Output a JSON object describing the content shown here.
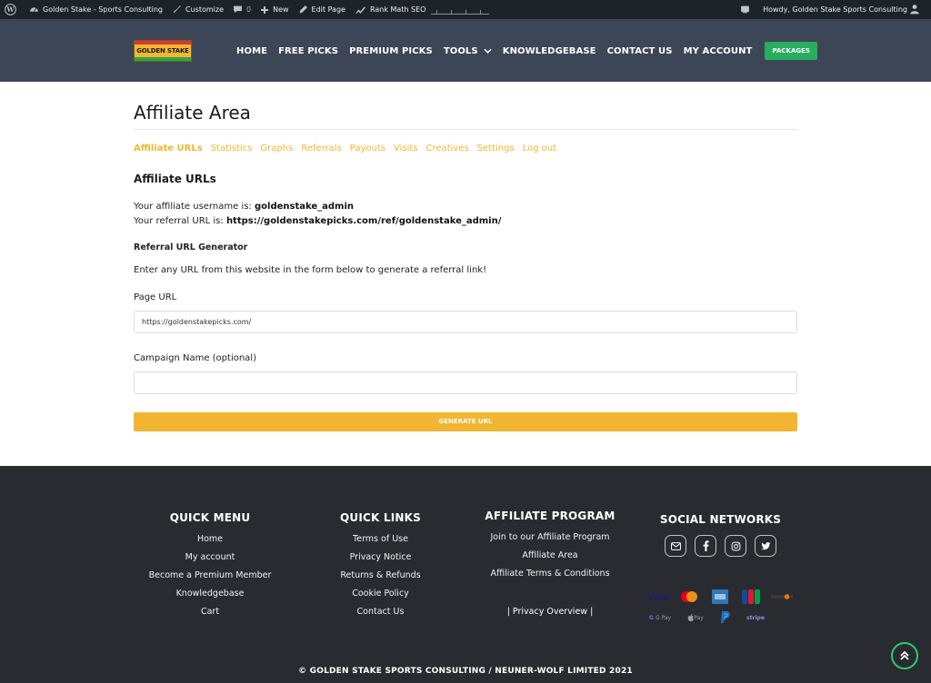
{
  "admin_bar": {
    "site_name": "Golden Stake - Sports Consulting",
    "customize": "Customize",
    "comments_count": "0",
    "new": "New",
    "edit_page": "Edit Page",
    "rank_math": "Rank Math SEO",
    "howdy": "Howdy, Golden Stake Sports Consulting"
  },
  "header": {
    "logo_text": "GOLDEN STAKE",
    "nav": [
      "HOME",
      "FREE PICKS",
      "PREMIUM PICKS",
      "TOOLS",
      "KNOWLEDGEBASE",
      "CONTACT US",
      "MY ACCOUNT"
    ],
    "packages_label": "PACKAGES"
  },
  "page": {
    "title": "Affiliate Area",
    "tabs": [
      "Affiliate URLs",
      "Statistics",
      "Graphs",
      "Referrals",
      "Payouts",
      "Visits",
      "Creatives",
      "Settings",
      "Log out"
    ],
    "section_title": "Affiliate URLs",
    "username_label": "Your affiliate username is:",
    "username_value": "goldenstake_admin",
    "referral_label": "Your referral URL is:",
    "referral_value": "https://goldenstakepicks.com/ref/goldenstake_admin/",
    "generator_title": "Referral URL Generator",
    "generator_desc": "Enter any URL from this website in the form below to generate a referral link!",
    "page_url_label": "Page URL",
    "page_url_value": "https://goldenstakepicks.com/",
    "campaign_label": "Campaign Name (optional)",
    "campaign_value": "",
    "generate_label": "GENERATE URL"
  },
  "footer": {
    "quick_menu": {
      "title": "QUICK MENU",
      "items": [
        "Home",
        "My account",
        "Become a Premium Member",
        "Knowledgebase",
        "Cart"
      ]
    },
    "quick_links": {
      "title": "QUICK LINKS",
      "items": [
        "Terms of Use",
        "Privacy Notice",
        "Returns & Refunds",
        "Cookie Policy",
        "Contact Us"
      ]
    },
    "affiliate": {
      "title": "AFFILIATE PROGRAM",
      "items": [
        "Join to our Affiliate Program",
        "Affiliate Area",
        "Affiliate Terms & Conditions"
      ],
      "privacy": "| Privacy Overview |"
    },
    "social": {
      "title": "SOCIAL NETWORKS",
      "icons": [
        "email-icon",
        "facebook-icon",
        "instagram-icon",
        "twitter-icon"
      ]
    },
    "payments": {
      "row1": [
        "visa-icon",
        "mastercard-icon",
        "amex-icon",
        "jcb-icon",
        "discover-icon"
      ],
      "gpay": "G Pay",
      "applepay": "Pay",
      "stripe": "stripe"
    },
    "copyright": "© GOLDEN STAKE SPORTS CONSULTING / NEUNER-WOLF LIMITED 2021"
  },
  "colors": {
    "accent": "#f2b632",
    "header_bg": "#3d4656",
    "footer_bg": "#292b30",
    "packages_bg": "#27ae60",
    "admin_bar_bg": "#1d2327"
  }
}
